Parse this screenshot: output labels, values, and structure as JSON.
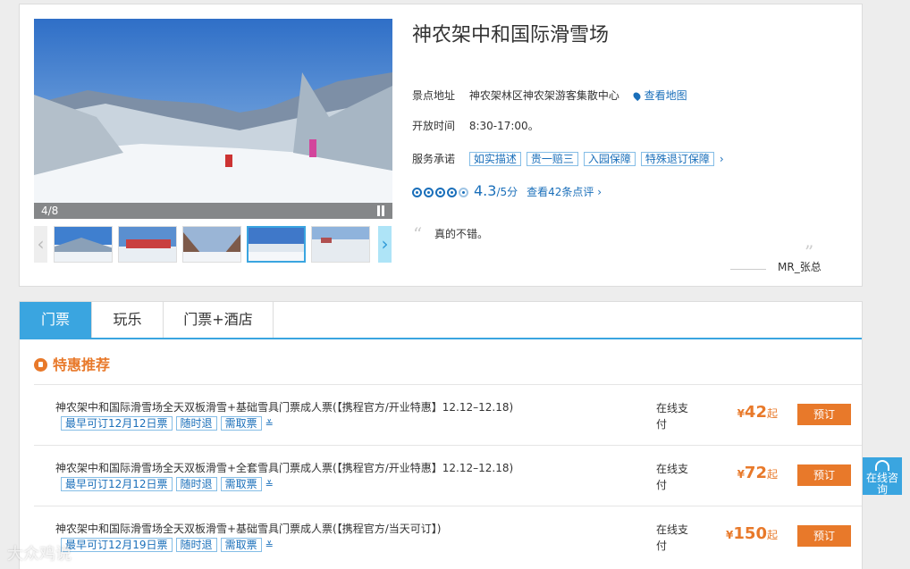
{
  "gallery": {
    "counter": "4/8",
    "prev_label": "‹",
    "next_label": "›"
  },
  "attraction": {
    "name": "神农架中和国际滑雪场",
    "address_label": "景点地址",
    "address": "神农架林区神农架游客集散中心",
    "map_link": "查看地图",
    "hours_label": "开放时间",
    "hours": "8:30-17:00。",
    "service_label": "服务承诺",
    "service_tags": [
      "如实描述",
      "贵一赔三",
      "入园保障",
      "特殊退订保障"
    ],
    "score": "4.3",
    "score_max": "/5分",
    "reviews_link": "查看42条点评",
    "quote": "真的不错。",
    "quote_author": "MR_张总"
  },
  "tabs": [
    "门票",
    "玩乐",
    "门票+酒店"
  ],
  "section_title": "特惠推荐",
  "tickets": [
    {
      "name": "神农架中和国际滑雪场全天双板滑雪+基础雪具门票成人票(【携程官方/开业特惠】12.12–12.18)",
      "tags": [
        "最早可订12月12日票",
        "随时退",
        "需取票"
      ],
      "pay": "在线支付",
      "currency": "¥",
      "price": "42",
      "suffix": "起",
      "button": "预订"
    },
    {
      "name": "神农架中和国际滑雪场全天双板滑雪+全套雪具门票成人票(【携程官方/开业特惠】12.12–12.18)",
      "tags": [
        "最早可订12月12日票",
        "随时退",
        "需取票"
      ],
      "pay": "在线支付",
      "currency": "¥",
      "price": "72",
      "suffix": "起",
      "button": "预订"
    },
    {
      "name": "神农架中和国际滑雪场全天双板滑雪+基础雪具门票成人票(【携程官方/当天可订】)",
      "tags": [
        "最早可订12月19日票",
        "随时退",
        "需取票"
      ],
      "pay": "在线支付",
      "currency": "¥",
      "price": "150",
      "suffix": "起",
      "button": "预订"
    }
  ],
  "consult_label": "在线咨询",
  "watermark": "大众鸡说",
  "colors": {
    "accent": "#3aa5e0",
    "link": "#1a6fba",
    "orange": "#e8792a"
  }
}
